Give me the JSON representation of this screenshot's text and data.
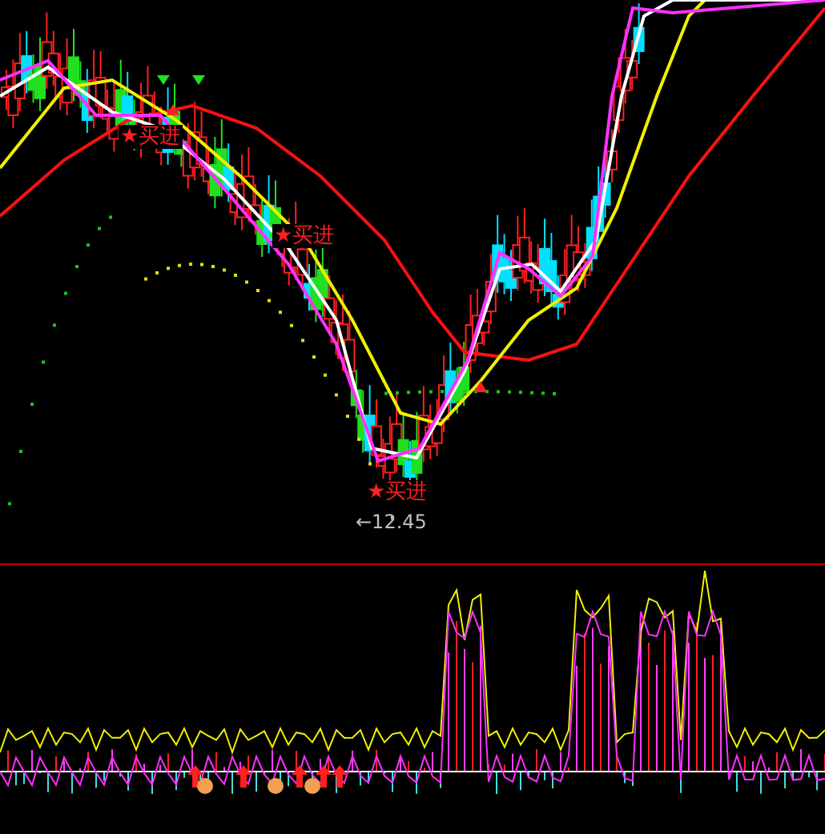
{
  "price_chart": {
    "signals": [
      {
        "text": "★买进"
      },
      {
        "text": "★买进"
      },
      {
        "text": "★买进"
      }
    ],
    "low_price_label": "←12.45"
  }
}
